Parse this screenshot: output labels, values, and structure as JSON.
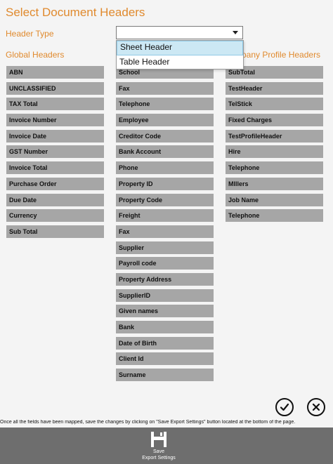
{
  "page": {
    "title": "Select Document Headers"
  },
  "header_type": {
    "label": "Header Type",
    "value": "",
    "options": [
      "Sheet Header",
      "Table Header"
    ]
  },
  "columns": {
    "global": {
      "header": "Global Headers",
      "items": [
        "ABN",
        "UNCLASSIFIED",
        "TAX Total",
        "Invoice Number",
        "Invoice Date",
        "GST Number",
        "Invoice Total",
        "Purchase Order",
        "Due Date",
        "Currency",
        "Sub Total"
      ]
    },
    "middle": {
      "header": "",
      "items": [
        "School",
        "Fax",
        "Telephone",
        "Employee",
        "Creditor Code",
        "Bank Account",
        "Phone",
        "Property ID",
        "Property Code",
        "Freight",
        "Fax",
        "Supplier",
        "Payroll code",
        "Property Address",
        "SupplierID",
        "Given names",
        "Bank",
        "Date of Birth",
        "Client Id",
        "Surname"
      ]
    },
    "company": {
      "header": "pany Profile Headers",
      "items": [
        "SubTotal",
        "TestHeader",
        "TelStick",
        "Fixed Charges",
        "TestProfileHeader",
        "Hire",
        "Telephone",
        "MIllers",
        "Job Name",
        "Telephone"
      ]
    }
  },
  "actions": {
    "confirm_icon": "check-icon",
    "cancel_icon": "close-icon"
  },
  "footer": {
    "note": "Once all the fields have been mapped, save the changes by clicking on \"Save Export Settings\" button located at the bottom of the page.",
    "save_label_line1": "Save",
    "save_label_line2": "Export Settings"
  },
  "colors": {
    "accent": "#e08a2e",
    "tile": "#a6a6a6",
    "appbar": "#6e6e6e",
    "selected_option": "#cce8f4"
  }
}
